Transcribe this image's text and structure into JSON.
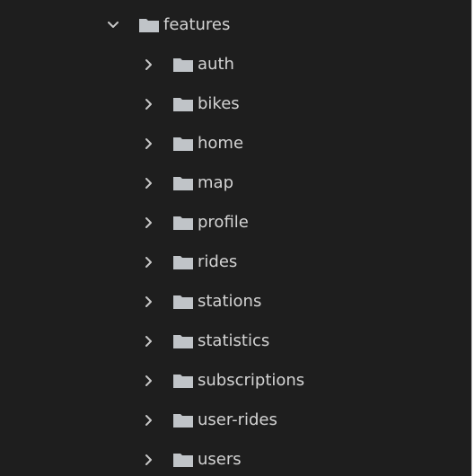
{
  "explorer": {
    "root": {
      "label": "features",
      "expanded": true,
      "chevron_icon": "chevron-down-icon",
      "folder_icon": "folder-icon"
    },
    "children": [
      {
        "label": "auth",
        "expanded": false,
        "chevron_icon": "chevron-right-icon",
        "folder_icon": "folder-icon"
      },
      {
        "label": "bikes",
        "expanded": false,
        "chevron_icon": "chevron-right-icon",
        "folder_icon": "folder-icon"
      },
      {
        "label": "home",
        "expanded": false,
        "chevron_icon": "chevron-right-icon",
        "folder_icon": "folder-icon"
      },
      {
        "label": "map",
        "expanded": false,
        "chevron_icon": "chevron-right-icon",
        "folder_icon": "folder-icon"
      },
      {
        "label": "profile",
        "expanded": false,
        "chevron_icon": "chevron-right-icon",
        "folder_icon": "folder-icon"
      },
      {
        "label": "rides",
        "expanded": false,
        "chevron_icon": "chevron-right-icon",
        "folder_icon": "folder-icon"
      },
      {
        "label": "stations",
        "expanded": false,
        "chevron_icon": "chevron-right-icon",
        "folder_icon": "folder-icon"
      },
      {
        "label": "statistics",
        "expanded": false,
        "chevron_icon": "chevron-right-icon",
        "folder_icon": "folder-icon"
      },
      {
        "label": "subscriptions",
        "expanded": false,
        "chevron_icon": "chevron-right-icon",
        "folder_icon": "folder-icon"
      },
      {
        "label": "user-rides",
        "expanded": false,
        "chevron_icon": "chevron-right-icon",
        "folder_icon": "folder-icon"
      },
      {
        "label": "users",
        "expanded": false,
        "chevron_icon": "chevron-right-icon",
        "folder_icon": "folder-icon"
      }
    ]
  },
  "colors": {
    "background": "#1e1e1e",
    "text": "#d4d4d4",
    "icon": "#b8b8b8",
    "folder": "#c0c4c8",
    "border": "#d8d8d8"
  }
}
